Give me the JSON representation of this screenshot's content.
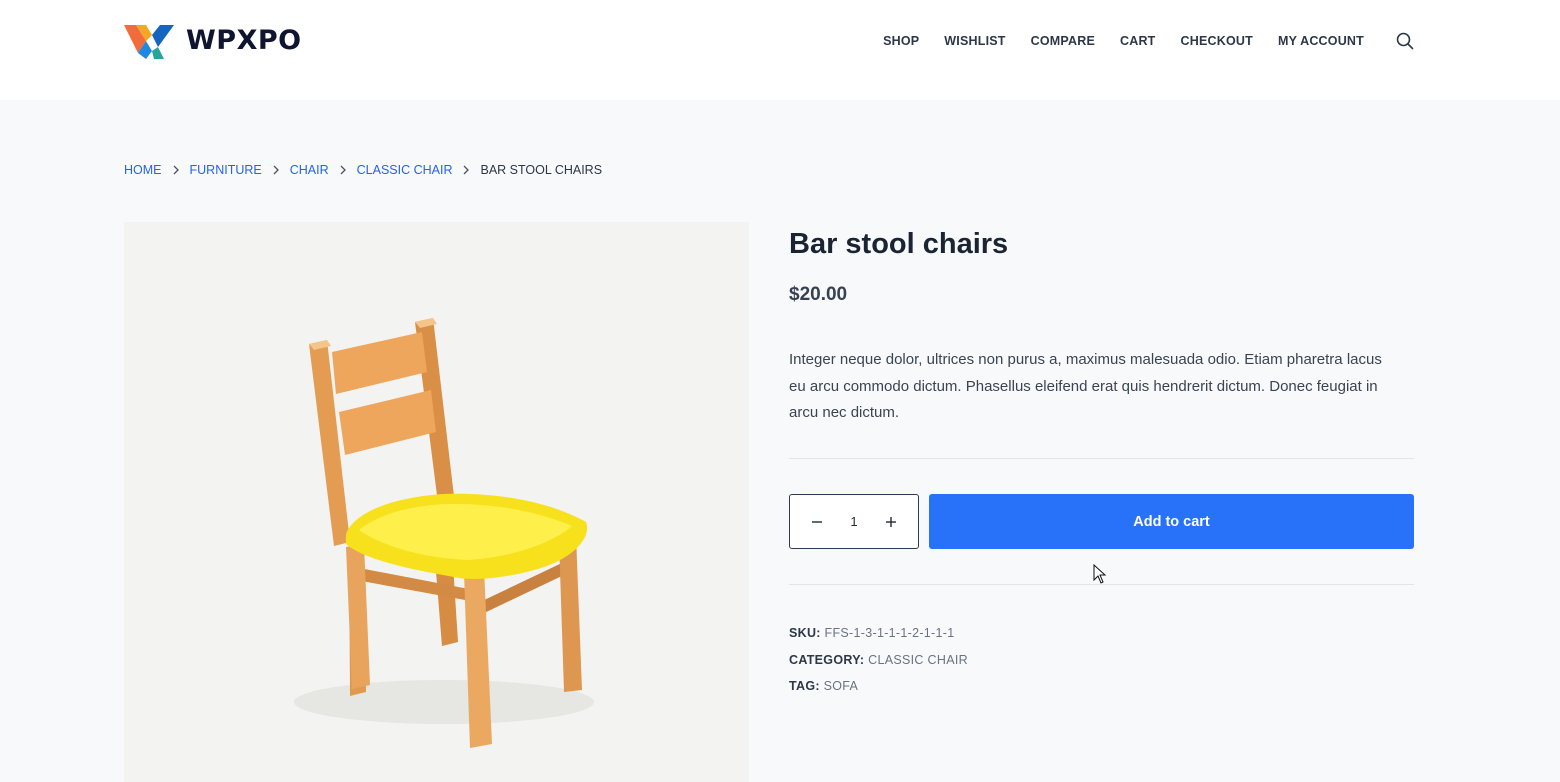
{
  "header": {
    "logo_text": "WPXPO",
    "nav": [
      {
        "label": "SHOP"
      },
      {
        "label": "WISHLIST"
      },
      {
        "label": "COMPARE"
      },
      {
        "label": "CART"
      },
      {
        "label": "CHECKOUT"
      },
      {
        "label": "MY ACCOUNT"
      }
    ],
    "search_icon": "search-icon"
  },
  "breadcrumb": {
    "links": [
      "HOME",
      "FURNITURE",
      "CHAIR",
      "CLASSIC CHAIR"
    ],
    "current": "BAR STOOL CHAIRS"
  },
  "product": {
    "title": "Bar stool chairs",
    "price": "$20.00",
    "description": "Integer neque dolor, ultrices non purus a, maximus malesuada odio. Etiam pharetra lacus eu arcu commodo dictum. Phasellus eleifend erat quis hendrerit dictum. Donec feugiat in arcu nec dictum.",
    "quantity": "1",
    "add_to_cart_label": "Add to cart",
    "sku_label": "SKU:",
    "sku": "FFS-1-3-1-1-1-2-1-1-1",
    "category_label": "CATEGORY:",
    "category": "CLASSIC CHAIR",
    "tag_label": "TAG:",
    "tag": "SOFA"
  },
  "colors": {
    "accent": "#2872fa",
    "link": "#2563eb",
    "heading": "#1a2433",
    "background": "#f8f9fb"
  }
}
